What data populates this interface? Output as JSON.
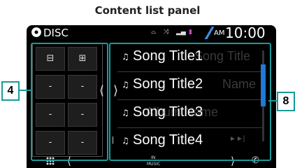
{
  "caption": "Content list panel",
  "status_bar": {
    "source": "DISC",
    "icons": [
      "disc-icon",
      "loudness-icon",
      "repeat-icon",
      "phone-signal-icon",
      "battery-icon"
    ],
    "am_pm": "AM",
    "time": "10:00"
  },
  "left_panel": {
    "buttons": [
      {
        "icon": "folder-up-icon",
        "label": "⊟"
      },
      {
        "icon": "folder-add-icon",
        "label": "⊞"
      },
      {
        "label": "-"
      },
      {
        "label": "-"
      },
      {
        "label": "-"
      },
      {
        "label": "-"
      },
      {
        "label": "-"
      },
      {
        "label": "-"
      }
    ]
  },
  "songs": [
    {
      "title": "Song Title1",
      "ghost": "Song Title"
    },
    {
      "title": "Song Title2",
      "ghost": "Name"
    },
    {
      "title": "Song Title3",
      "ghost": "Album Name"
    },
    {
      "title": "Song Title4",
      "ghost": ""
    }
  ],
  "bottom_bar": {
    "in_label": "IN",
    "music_label": "MUSIC"
  },
  "callouts": {
    "left": "4",
    "right": "8"
  },
  "colors": {
    "callout_border": "#1a9a9a",
    "scroll_thumb": "#1f7ad6"
  }
}
